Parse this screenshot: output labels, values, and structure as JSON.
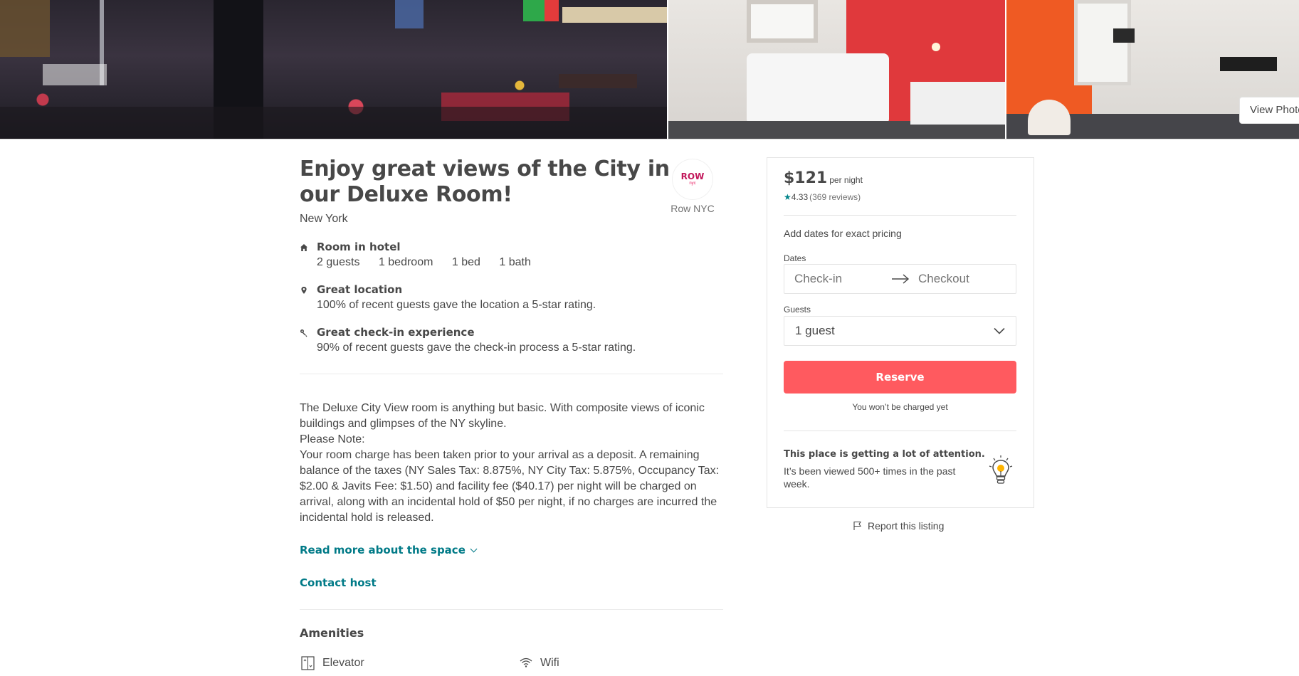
{
  "hero": {
    "view_photos_label": "View Photos"
  },
  "listing": {
    "title": "Enjoy great views of the City in our Deluxe Room!",
    "city": "New York",
    "host": {
      "logo_text": "ROW",
      "logo_sub": "nyc",
      "name": "Row NYC"
    },
    "features": [
      {
        "icon": "home-icon",
        "title": "Room in hotel",
        "details": [
          "2 guests",
          "1 bedroom",
          "1 bed",
          "1 bath"
        ]
      },
      {
        "icon": "location-pin-icon",
        "title": "Great location",
        "description": "100% of recent guests gave the location a 5-star rating."
      },
      {
        "icon": "key-icon",
        "title": "Great check-in experience",
        "description": "90% of recent guests gave the check-in process a 5-star rating."
      }
    ],
    "description": [
      "The Deluxe City View room is anything but basic. With composite views of iconic buildings and glimpses of the NY skyline.",
      "Please Note:",
      "Your room charge has been taken prior to your arrival as a deposit. A remaining balance of the taxes (NY Sales Tax: 8.875%, NY City Tax: 5.875%, Occupancy Tax: $2.00 & Javits Fee: $1.50) and facility fee ($40.17) per night will be charged on arrival, along with an incidental hold of $50 per night, if no charges are incurred the incidental hold is released."
    ],
    "read_more_label": "Read more about the space",
    "contact_host_label": "Contact host",
    "amenities": {
      "title": "Amenities",
      "items": [
        {
          "icon": "elevator-icon",
          "label": "Elevator"
        },
        {
          "icon": "wifi-icon",
          "label": "Wifi"
        }
      ]
    }
  },
  "booking": {
    "price": "$121",
    "per_night": "per night",
    "rating": "4.33",
    "reviews": "(369 reviews)",
    "pricing_note": "Add dates for exact pricing",
    "dates_label": "Dates",
    "checkin_placeholder": "Check-in",
    "checkout_placeholder": "Checkout",
    "guests_label": "Guests",
    "guests_value": "1 guest",
    "reserve_label": "Reserve",
    "no_charge_note": "You won’t be charged yet",
    "attention_title": "This place is getting a lot of attention.",
    "attention_desc": "It’s been viewed 500+ times in the past week.",
    "accent_color": "#ff5a5f",
    "link_color": "#007a87"
  },
  "report": {
    "label": "Report this listing"
  }
}
